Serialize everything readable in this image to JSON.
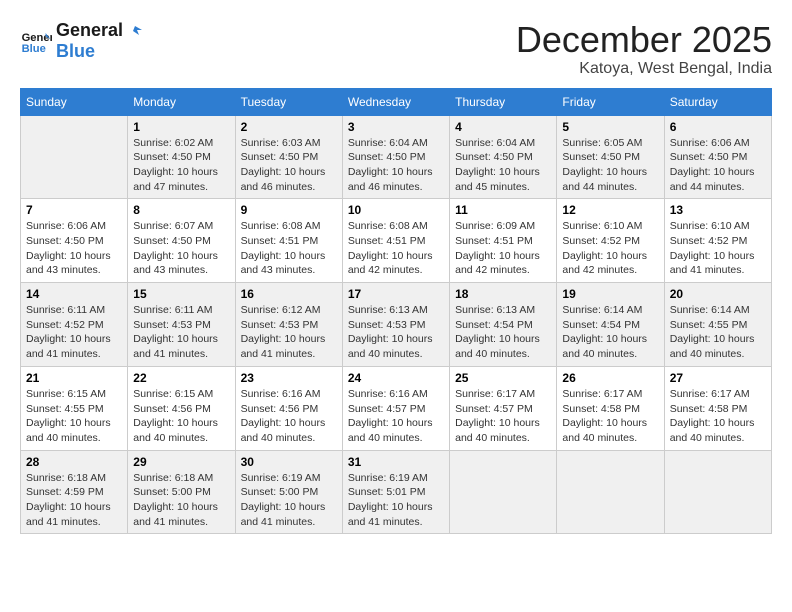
{
  "logo": {
    "line1": "General",
    "line2": "Blue"
  },
  "title": "December 2025",
  "location": "Katoya, West Bengal, India",
  "days_of_week": [
    "Sunday",
    "Monday",
    "Tuesday",
    "Wednesday",
    "Thursday",
    "Friday",
    "Saturday"
  ],
  "weeks": [
    [
      {
        "day": "",
        "sunrise": "",
        "sunset": "",
        "daylight": ""
      },
      {
        "day": "1",
        "sunrise": "Sunrise: 6:02 AM",
        "sunset": "Sunset: 4:50 PM",
        "daylight": "Daylight: 10 hours and 47 minutes."
      },
      {
        "day": "2",
        "sunrise": "Sunrise: 6:03 AM",
        "sunset": "Sunset: 4:50 PM",
        "daylight": "Daylight: 10 hours and 46 minutes."
      },
      {
        "day": "3",
        "sunrise": "Sunrise: 6:04 AM",
        "sunset": "Sunset: 4:50 PM",
        "daylight": "Daylight: 10 hours and 46 minutes."
      },
      {
        "day": "4",
        "sunrise": "Sunrise: 6:04 AM",
        "sunset": "Sunset: 4:50 PM",
        "daylight": "Daylight: 10 hours and 45 minutes."
      },
      {
        "day": "5",
        "sunrise": "Sunrise: 6:05 AM",
        "sunset": "Sunset: 4:50 PM",
        "daylight": "Daylight: 10 hours and 44 minutes."
      },
      {
        "day": "6",
        "sunrise": "Sunrise: 6:06 AM",
        "sunset": "Sunset: 4:50 PM",
        "daylight": "Daylight: 10 hours and 44 minutes."
      }
    ],
    [
      {
        "day": "7",
        "sunrise": "Sunrise: 6:06 AM",
        "sunset": "Sunset: 4:50 PM",
        "daylight": "Daylight: 10 hours and 43 minutes."
      },
      {
        "day": "8",
        "sunrise": "Sunrise: 6:07 AM",
        "sunset": "Sunset: 4:50 PM",
        "daylight": "Daylight: 10 hours and 43 minutes."
      },
      {
        "day": "9",
        "sunrise": "Sunrise: 6:08 AM",
        "sunset": "Sunset: 4:51 PM",
        "daylight": "Daylight: 10 hours and 43 minutes."
      },
      {
        "day": "10",
        "sunrise": "Sunrise: 6:08 AM",
        "sunset": "Sunset: 4:51 PM",
        "daylight": "Daylight: 10 hours and 42 minutes."
      },
      {
        "day": "11",
        "sunrise": "Sunrise: 6:09 AM",
        "sunset": "Sunset: 4:51 PM",
        "daylight": "Daylight: 10 hours and 42 minutes."
      },
      {
        "day": "12",
        "sunrise": "Sunrise: 6:10 AM",
        "sunset": "Sunset: 4:52 PM",
        "daylight": "Daylight: 10 hours and 42 minutes."
      },
      {
        "day": "13",
        "sunrise": "Sunrise: 6:10 AM",
        "sunset": "Sunset: 4:52 PM",
        "daylight": "Daylight: 10 hours and 41 minutes."
      }
    ],
    [
      {
        "day": "14",
        "sunrise": "Sunrise: 6:11 AM",
        "sunset": "Sunset: 4:52 PM",
        "daylight": "Daylight: 10 hours and 41 minutes."
      },
      {
        "day": "15",
        "sunrise": "Sunrise: 6:11 AM",
        "sunset": "Sunset: 4:53 PM",
        "daylight": "Daylight: 10 hours and 41 minutes."
      },
      {
        "day": "16",
        "sunrise": "Sunrise: 6:12 AM",
        "sunset": "Sunset: 4:53 PM",
        "daylight": "Daylight: 10 hours and 41 minutes."
      },
      {
        "day": "17",
        "sunrise": "Sunrise: 6:13 AM",
        "sunset": "Sunset: 4:53 PM",
        "daylight": "Daylight: 10 hours and 40 minutes."
      },
      {
        "day": "18",
        "sunrise": "Sunrise: 6:13 AM",
        "sunset": "Sunset: 4:54 PM",
        "daylight": "Daylight: 10 hours and 40 minutes."
      },
      {
        "day": "19",
        "sunrise": "Sunrise: 6:14 AM",
        "sunset": "Sunset: 4:54 PM",
        "daylight": "Daylight: 10 hours and 40 minutes."
      },
      {
        "day": "20",
        "sunrise": "Sunrise: 6:14 AM",
        "sunset": "Sunset: 4:55 PM",
        "daylight": "Daylight: 10 hours and 40 minutes."
      }
    ],
    [
      {
        "day": "21",
        "sunrise": "Sunrise: 6:15 AM",
        "sunset": "Sunset: 4:55 PM",
        "daylight": "Daylight: 10 hours and 40 minutes."
      },
      {
        "day": "22",
        "sunrise": "Sunrise: 6:15 AM",
        "sunset": "Sunset: 4:56 PM",
        "daylight": "Daylight: 10 hours and 40 minutes."
      },
      {
        "day": "23",
        "sunrise": "Sunrise: 6:16 AM",
        "sunset": "Sunset: 4:56 PM",
        "daylight": "Daylight: 10 hours and 40 minutes."
      },
      {
        "day": "24",
        "sunrise": "Sunrise: 6:16 AM",
        "sunset": "Sunset: 4:57 PM",
        "daylight": "Daylight: 10 hours and 40 minutes."
      },
      {
        "day": "25",
        "sunrise": "Sunrise: 6:17 AM",
        "sunset": "Sunset: 4:57 PM",
        "daylight": "Daylight: 10 hours and 40 minutes."
      },
      {
        "day": "26",
        "sunrise": "Sunrise: 6:17 AM",
        "sunset": "Sunset: 4:58 PM",
        "daylight": "Daylight: 10 hours and 40 minutes."
      },
      {
        "day": "27",
        "sunrise": "Sunrise: 6:17 AM",
        "sunset": "Sunset: 4:58 PM",
        "daylight": "Daylight: 10 hours and 40 minutes."
      }
    ],
    [
      {
        "day": "28",
        "sunrise": "Sunrise: 6:18 AM",
        "sunset": "Sunset: 4:59 PM",
        "daylight": "Daylight: 10 hours and 41 minutes."
      },
      {
        "day": "29",
        "sunrise": "Sunrise: 6:18 AM",
        "sunset": "Sunset: 5:00 PM",
        "daylight": "Daylight: 10 hours and 41 minutes."
      },
      {
        "day": "30",
        "sunrise": "Sunrise: 6:19 AM",
        "sunset": "Sunset: 5:00 PM",
        "daylight": "Daylight: 10 hours and 41 minutes."
      },
      {
        "day": "31",
        "sunrise": "Sunrise: 6:19 AM",
        "sunset": "Sunset: 5:01 PM",
        "daylight": "Daylight: 10 hours and 41 minutes."
      },
      {
        "day": "",
        "sunrise": "",
        "sunset": "",
        "daylight": ""
      },
      {
        "day": "",
        "sunrise": "",
        "sunset": "",
        "daylight": ""
      },
      {
        "day": "",
        "sunrise": "",
        "sunset": "",
        "daylight": ""
      }
    ]
  ],
  "shaded_rows": [
    0,
    2,
    4
  ]
}
